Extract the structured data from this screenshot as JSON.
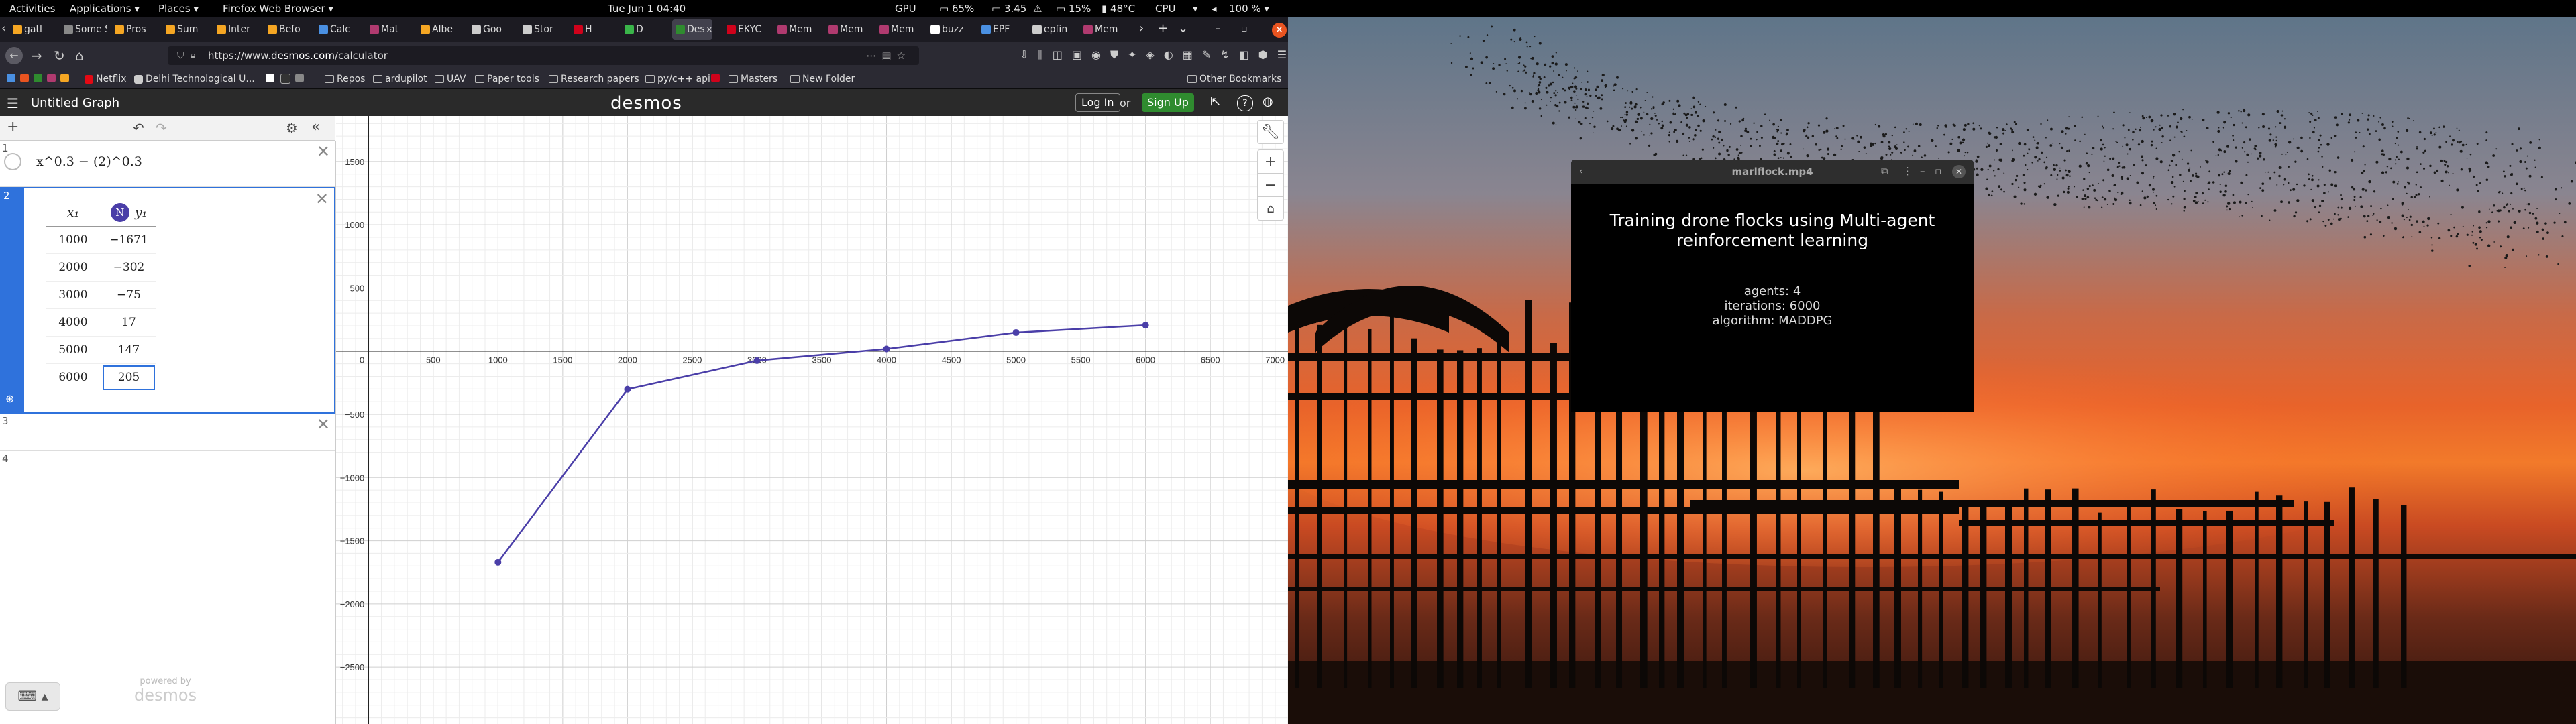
{
  "topbar": {
    "activities": "Activities",
    "applications": "Applications ▾",
    "places": "Places ▾",
    "app_menu": "Firefox Web Browser ▾",
    "clock": "Tue Jun 1  04:40",
    "gpu": "GPU",
    "mem": "65%",
    "temp1": "3.45",
    "disk": "15%",
    "temp2": "48°C",
    "cpu": "CPU",
    "battery": "100 % ▾"
  },
  "firefox": {
    "tabs": [
      {
        "label": "gatl",
        "color": "#f5a623"
      },
      {
        "label": "Some Su",
        "color": "#888888"
      },
      {
        "label": "Pros",
        "color": "#f5a623"
      },
      {
        "label": "Sum",
        "color": "#f5a623"
      },
      {
        "label": "Inter",
        "color": "#f5a623"
      },
      {
        "label": "Befo",
        "color": "#f5a623"
      },
      {
        "label": "Calc",
        "color": "#4a90e2"
      },
      {
        "label": "Mat",
        "color": "#b03a6f"
      },
      {
        "label": "Albe",
        "color": "#f5a623"
      },
      {
        "label": "Goo",
        "color": "#cccccc"
      },
      {
        "label": "Stor",
        "color": "#cccccc"
      },
      {
        "label": "H",
        "color": "#d0021b"
      },
      {
        "label": "D",
        "color": "#3ab54a"
      },
      {
        "label": "Desm",
        "color": "#2f8b2f"
      },
      {
        "label": "EKYC",
        "color": "#d0021b"
      },
      {
        "label": "Mem",
        "color": "#b03a6f"
      },
      {
        "label": "Mem",
        "color": "#b03a6f"
      },
      {
        "label": "Mem",
        "color": "#b03a6f"
      },
      {
        "label": "buzz",
        "color": "#ffffff"
      },
      {
        "label": "EPF",
        "color": "#4a90e2"
      },
      {
        "label": "epfin",
        "color": "#cccccc"
      },
      {
        "label": "Mem",
        "color": "#b03a6f"
      }
    ],
    "url_host": "https://www.",
    "url_domain": "desmos.com",
    "url_path": "/calculator",
    "bookmarks": [
      {
        "label": "Netflix",
        "color": "#e50914"
      },
      {
        "label": "Delhi Technological U...",
        "color": "#cccccc"
      },
      {
        "label": "Repos",
        "color": ""
      },
      {
        "label": "ardupilot",
        "color": ""
      },
      {
        "label": "UAV",
        "color": ""
      },
      {
        "label": "Paper tools",
        "color": ""
      },
      {
        "label": "Research papers",
        "color": ""
      },
      {
        "label": "py/c++ api",
        "color": ""
      },
      {
        "label": "Masters",
        "color": ""
      },
      {
        "label": "New Folder",
        "color": ""
      }
    ],
    "other_bookmarks": "Other Bookmarks"
  },
  "desmos": {
    "title": "Untitled Graph",
    "logo": "desmos",
    "login": "Log In",
    "or": "or",
    "signup": "Sign Up",
    "expr1": "x^0.3 − (2)^0.3",
    "expr_numbers": [
      "1",
      "2",
      "3",
      "4"
    ],
    "table": {
      "x_header": "x₁",
      "y_header": "y₁",
      "rows": [
        [
          "1000",
          "−1671"
        ],
        [
          "2000",
          "−302"
        ],
        [
          "3000",
          "−75"
        ],
        [
          "4000",
          "17"
        ],
        [
          "5000",
          "147"
        ],
        [
          "6000",
          "205"
        ]
      ]
    },
    "powered_small": "powered by",
    "powered_big": "desmos"
  },
  "chart_data": {
    "type": "line",
    "x": [
      1000,
      2000,
      3000,
      4000,
      5000,
      6000
    ],
    "series": [
      {
        "values": [
          -1671,
          -302,
          -75,
          17,
          147,
          205
        ],
        "color": "#4a3ea8"
      }
    ],
    "xlim": [
      -250,
      7100
    ],
    "ylim": [
      -2950,
      1860
    ],
    "x_ticks": [
      "500",
      "1000",
      "1500",
      "2000",
      "2500",
      "3000",
      "3500",
      "4000",
      "4500",
      "5000",
      "5500",
      "6000",
      "6500",
      "7000"
    ],
    "y_ticks": [
      "1500",
      "1000",
      "500",
      "−500",
      "−1000",
      "−1500",
      "−2000",
      "−2500"
    ],
    "origin_label": "0",
    "grid": true
  },
  "video": {
    "window_title": "marlflock.mp4",
    "heading": "Training drone flocks using Multi-agent reinforcement learning",
    "info": [
      "agents: 4",
      "iterations: 6000",
      "algorithm: MADDPG"
    ]
  }
}
